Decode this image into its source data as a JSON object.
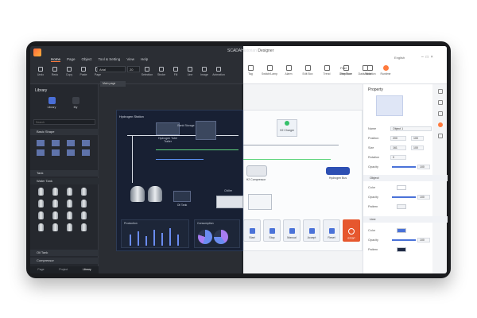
{
  "titlebar": {
    "app_title_dark": "SCADAHistorian",
    "app_title_light": "Designer",
    "language": "English"
  },
  "menu": [
    "Home",
    "Page",
    "Object",
    "Tool & Setting",
    "View",
    "Help"
  ],
  "ribbon_dark": {
    "tools": [
      "Undo",
      "Redo",
      "Copy",
      "Paste",
      "Page"
    ],
    "font": "Arial",
    "size": "20",
    "format_tools": [
      "Selection",
      "Stroke",
      "Fill",
      "Line",
      "Image",
      "Animation"
    ]
  },
  "ribbon_light": {
    "tools": [
      "Tag",
      "Switch/Lamp",
      "Alarm",
      "Edit Box",
      "Trend",
      "Date/Time",
      "Data Table"
    ],
    "find": "Find",
    "replace": "Replace",
    "validation": "Validation",
    "runtime": "Runtime"
  },
  "library": {
    "title": "Library",
    "tabs_icons": [
      "Library",
      "My"
    ],
    "search_placeholder": "Search",
    "sections": [
      "Basic Shape",
      "Tank",
      "Water Tank",
      "Oil Tank",
      "Compressor"
    ],
    "bottom_tabs": [
      "Page",
      "Project",
      "Library"
    ]
  },
  "canvas": {
    "doc_tab": "Main page",
    "station_title": "Hydrogen Station",
    "labels": {
      "tube_trailer": "Hydrogen Tube Trailer",
      "bank": "Bank Storage",
      "oil_tank": "Oil Tank",
      "chiller": "Chiller",
      "compressor": "H2 Compressor",
      "charger": "H2 Charger",
      "bus": "Hydrogen Bus",
      "production": "Production",
      "consumption": "Consumption"
    },
    "controls": [
      "Start",
      "Stop",
      "Manual",
      "Accept",
      "Reset"
    ],
    "stop_label": "STOP"
  },
  "property": {
    "title": "Property",
    "name_label": "Name",
    "name_value": "Object 1",
    "position_label": "Position",
    "position_x": "200",
    "position_y": "100",
    "size_label": "Size",
    "size_w": "161",
    "size_h": "100",
    "rotation_label": "Rotation",
    "rotation_value": "0",
    "opacity_label": "Opacity",
    "opacity_value": "100",
    "object_section": "Object",
    "color_label": "Color",
    "pattern_label": "Pattern",
    "line_section": "Line",
    "line_color_label": "Color",
    "line_opacity_label": "Opacity",
    "line_pattern_label": "Pattern",
    "opacity_level": 1.0
  },
  "colors": {
    "accent": "#ff7a3d",
    "blue": "#4a72d8",
    "stop": "#e6572e",
    "green": "#5fd47d"
  }
}
